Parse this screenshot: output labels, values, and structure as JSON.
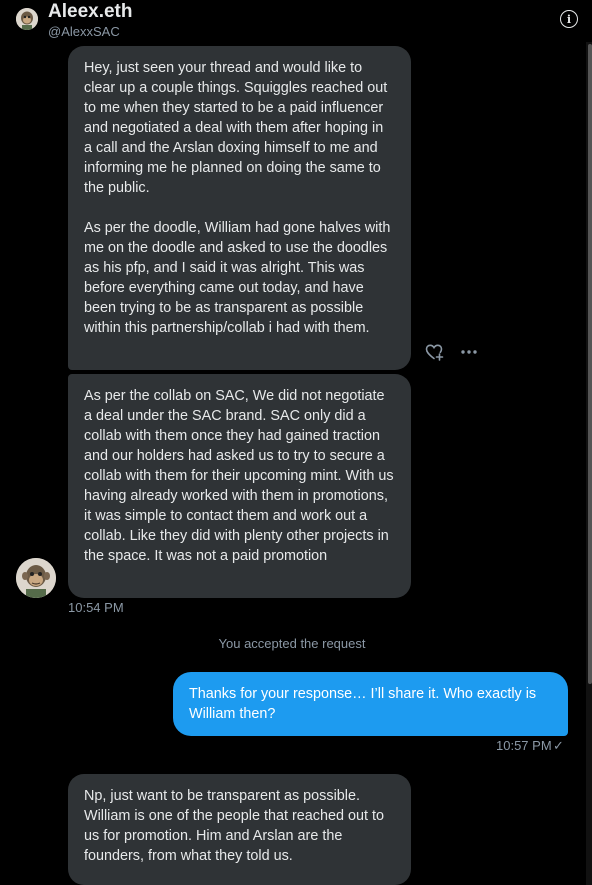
{
  "header": {
    "name": "Aleex.eth",
    "handle": "@AlexxSAC"
  },
  "messages": [
    {
      "text": "Hey, just seen your thread and would like to clear up a couple things. Squiggles reached out to me when they started to be a paid influencer and negotiated a deal with them after hoping in a call and the Arslan doxing himself to me and informing me he planned on doing the same to the public.\n\nAs per the doodle, William had gone halves with me on the doodle and asked to use the doodles as his pfp, and I said it was alright. This was before everything came out today, and have been trying to be as transparent as possible within this partnership/collab i had with them."
    },
    {
      "text": "As per the collab on SAC, We did not negotiate a deal under the SAC brand. SAC only did a collab with them once they had gained traction and our holders had asked us to try to secure a collab with them for their upcoming mint. With us having already worked with them in promotions, it was simple to contact them and work out a collab. Like they did with plenty other projects in the space. It was not a paid promotion"
    },
    {
      "time": "10:54 PM"
    },
    {
      "system": "You accepted the request"
    },
    {
      "text": "Thanks for your response… I’ll share it. Who exactly is William then?",
      "time": "10:57 PM",
      "status": "✓"
    },
    {
      "text": "Np, just want to be transparent as possible. William is one of the people that reached out to us for promotion. Him and Arslan are the founders, from what they told us."
    }
  ],
  "icons": {
    "info": "info-icon",
    "react": "heart-plus-icon",
    "more": "more-horizontal-icon"
  },
  "colors": {
    "background": "#000000",
    "received_bubble": "#2f3336",
    "sent_bubble": "#1d9bf0",
    "muted_text": "#8b98a5"
  }
}
